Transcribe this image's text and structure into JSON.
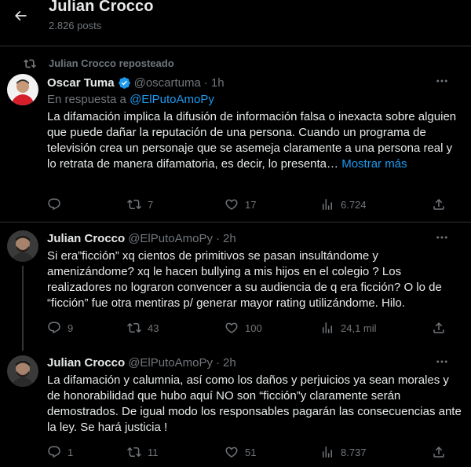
{
  "header": {
    "title": "Julian Crocco",
    "posts_count": "2.826 posts"
  },
  "tweets": [
    {
      "repost_label": "Julian Crocco reposteado",
      "author_name": "Oscar Tuma",
      "author_handle": "@oscartuma",
      "time": "1h",
      "reply_prefix": "En respuesta a ",
      "reply_mention": "@ElPutoAmoPy",
      "text": "La difamación implica la difusión de información falsa o inexacta sobre alguien que puede dañar la reputación de una persona. Cuando un programa de televisión crea un personaje que se asemeja claramente a una persona real y lo retrata de manera difamatoria, es decir, lo presenta…",
      "show_more": "Mostrar más",
      "replies": "",
      "reposts": "7",
      "likes": "17",
      "views": "6.724"
    },
    {
      "author_name": "Julian Crocco",
      "author_handle": "@ElPutoAmoPy",
      "time": "2h",
      "text": "Si era”ficción” xq cientos de primitivos se pasan insultándome y amenizándome? xq le hacen bullying a mis hijos en el colegio ? Los realizadores no lograron convencer a su audiencia de q era ficción? O lo de “ficción” fue otra mentiras p/ generar mayor rating utilizándome. Hilo.",
      "replies": "9",
      "reposts": "43",
      "likes": "100",
      "views": "24,1 mil"
    },
    {
      "author_name": "Julian Crocco",
      "author_handle": "@ElPutoAmoPy",
      "time": "2h",
      "text": "La difamación y calumnia, así como los daños y perjuicios ya sean morales y de honorabilidad que hubo aquí NO son “ficción”y claramente serán demostrados. De igual modo los responsables pagarán las consecuencias ante la ley. Se hará justicia !",
      "replies": "1",
      "reposts": "11",
      "likes": "51",
      "views": "8.737"
    }
  ],
  "colors": {
    "background": "#000000",
    "text": "#e7e9ea",
    "secondary": "#71767b",
    "accent": "#1d9bf0",
    "divider": "#2f3336"
  },
  "icons": [
    "back-arrow-icon",
    "repost-icon",
    "verified-badge-icon",
    "more-icon",
    "reply-icon",
    "like-icon",
    "views-icon",
    "share-icon"
  ]
}
